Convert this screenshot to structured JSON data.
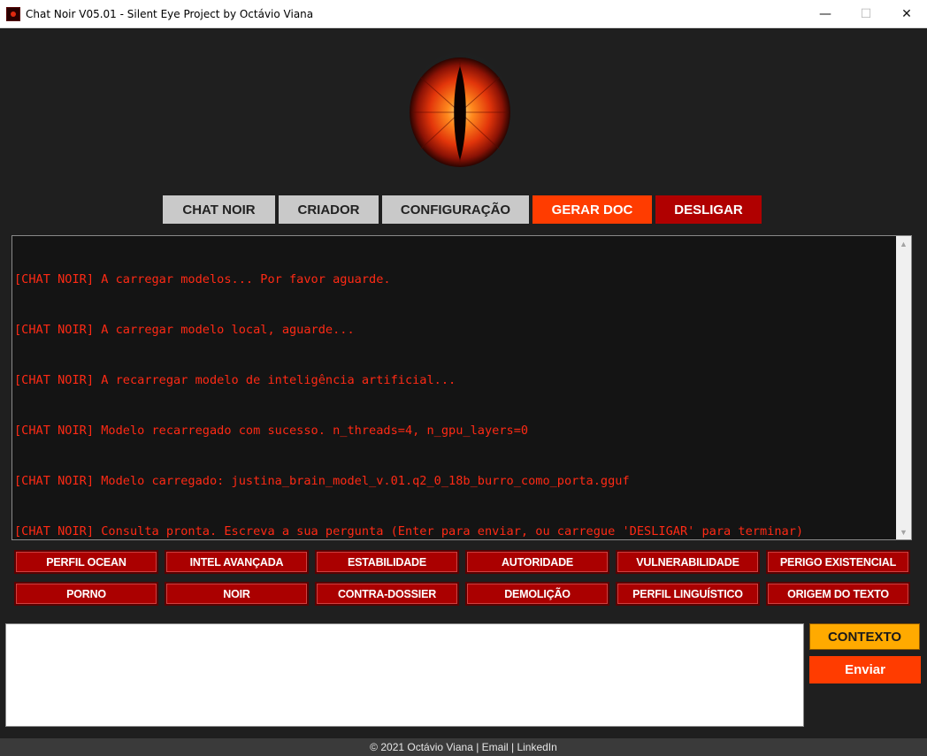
{
  "window": {
    "title": "Chat Noir V05.01 - Silent Eye Project by Octávio Viana",
    "minimize": "—",
    "maximize": "☐",
    "close": "✕"
  },
  "nav": {
    "chat_noir": "CHAT NOIR",
    "criador": "CRIADOR",
    "configuracao": "CONFIGURAÇÃO",
    "gerar_doc": "GERAR DOC",
    "desligar": "DESLIGAR"
  },
  "console": {
    "lines": [
      "[CHAT NOIR] A carregar modelos... Por favor aguarde.",
      "[CHAT NOIR] A carregar modelo local, aguarde...",
      "[CHAT NOIR] A recarregar modelo de inteligência artificial...",
      "[CHAT NOIR] Modelo recarregado com sucesso. n_threads=4, n_gpu_layers=0",
      "[CHAT NOIR] Modelo carregado: justina_brain_model_v.01.q2_0_18b_burro_como_porta.gguf",
      "[CHAT NOIR] Consulta pronta. Escreva a sua pergunta (Enter para enviar, ou carregue 'DESLIGAR' para terminar)"
    ]
  },
  "quick_actions": {
    "row1": [
      "PERFIL OCEAN",
      "INTEL AVANÇADA",
      "ESTABILIDADE",
      "AUTORIDADE",
      "VULNERABILIDADE",
      "PERIGO EXISTENCIAL"
    ],
    "row2": [
      "PORNO",
      "NOIR",
      "CONTRA-DOSSIER",
      "DEMOLIÇÃO",
      "PERFIL LINGUÍSTICO",
      "ORIGEM DO TEXTO"
    ]
  },
  "input": {
    "value": ""
  },
  "buttons": {
    "contexto": "CONTEXTO",
    "enviar": "Enviar"
  },
  "footer": {
    "text": "© 2021 Octávio Viana | Email | LinkedIn"
  },
  "colors": {
    "background": "#1f1f1f",
    "console_text": "#ff2a14",
    "accent_orange": "#ff3c00",
    "accent_red": "#b00000",
    "context_yellow": "#ffaa00"
  }
}
